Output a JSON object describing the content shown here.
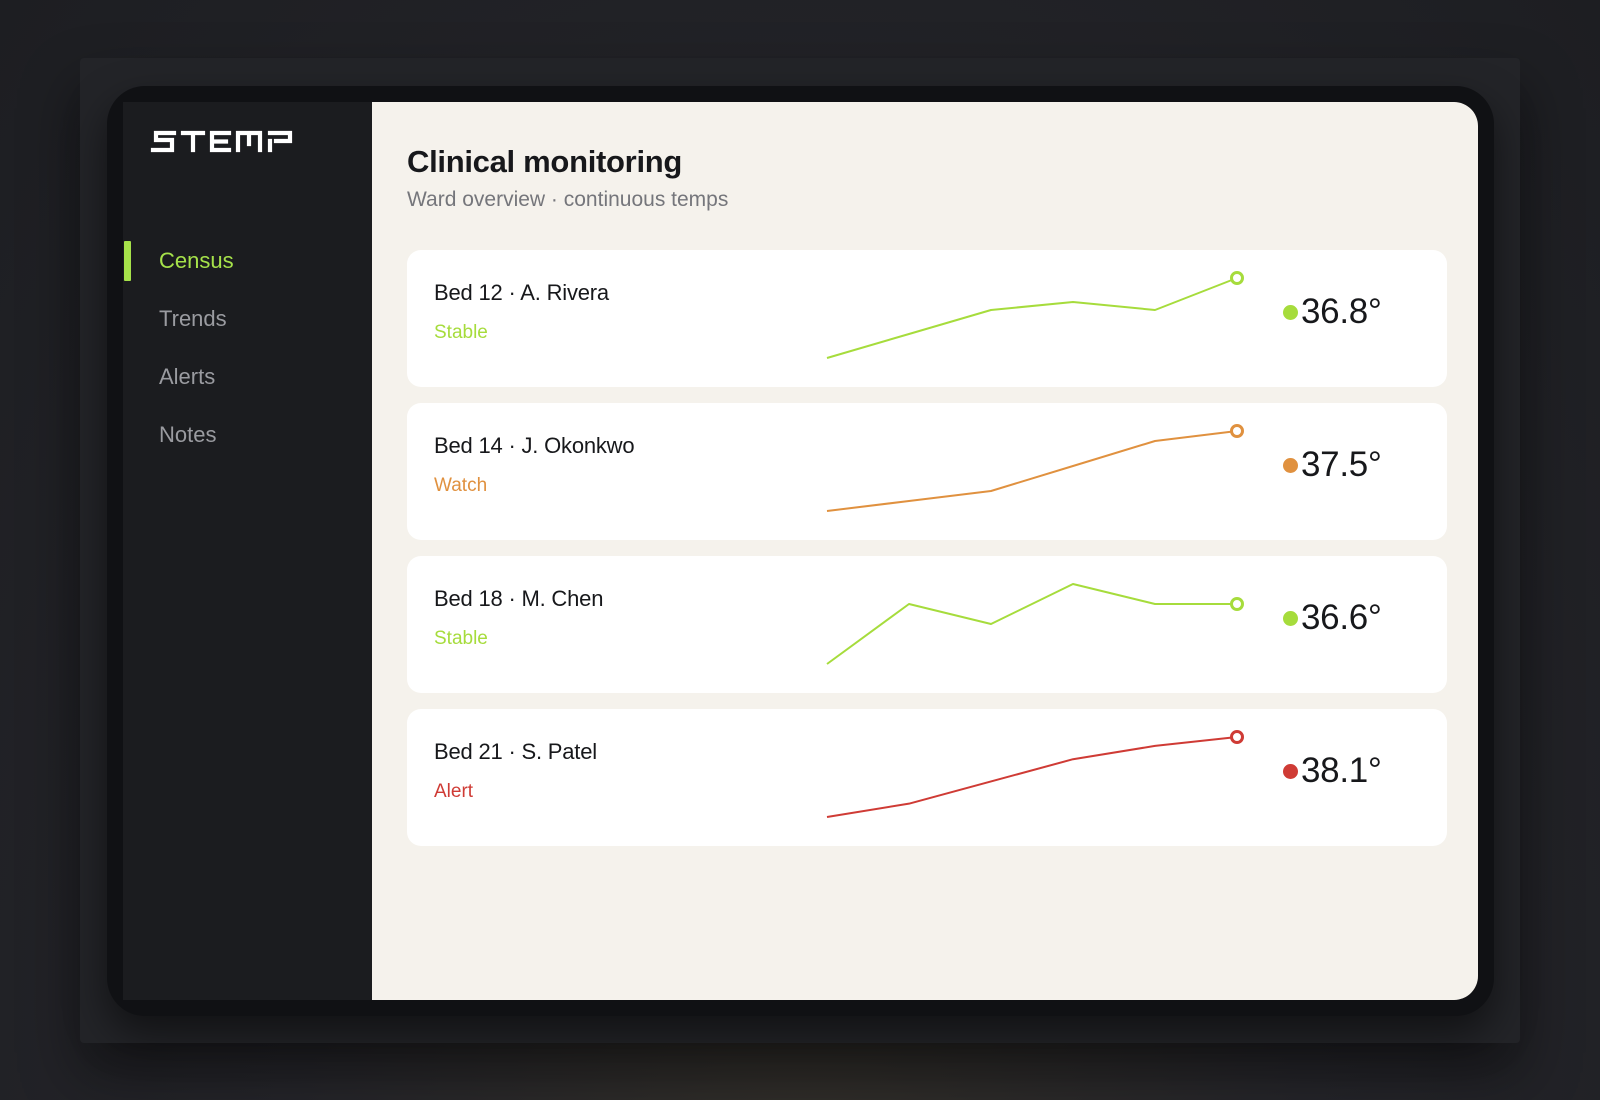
{
  "app": {
    "logo_text": "STEMP",
    "accent": "#a6e24a"
  },
  "sidebar": {
    "items": [
      {
        "label": "Census",
        "active": true
      },
      {
        "label": "Trends",
        "active": false
      },
      {
        "label": "Alerts",
        "active": false
      },
      {
        "label": "Notes",
        "active": false
      }
    ]
  },
  "header": {
    "title": "Clinical monitoring",
    "subtitle": "Ward overview · continuous temps"
  },
  "patients": [
    {
      "name": "Bed 12 · A. Rivera",
      "status": "Stable",
      "color": "#a6dc3c",
      "reading": "36.8°",
      "trend": [
        36.3,
        36.45,
        36.6,
        36.65,
        36.6,
        36.8
      ]
    },
    {
      "name": "Bed 14 · J. Okonkwo",
      "status": "Watch",
      "color": "#e0913f",
      "reading": "37.5°",
      "trend": [
        36.6,
        36.7,
        36.8,
        37.05,
        37.3,
        37.4
      ]
    },
    {
      "name": "Bed 18 · M. Chen",
      "status": "Stable",
      "color": "#a6dc3c",
      "reading": "36.6°",
      "trend": [
        36.35,
        36.65,
        36.55,
        36.75,
        36.65,
        36.65
      ]
    },
    {
      "name": "Bed 21 · S. Patel",
      "status": "Alert",
      "color": "#cf3b35",
      "reading": "38.1°",
      "trend": [
        37.2,
        37.35,
        37.6,
        37.85,
        38.0,
        38.1
      ]
    }
  ]
}
